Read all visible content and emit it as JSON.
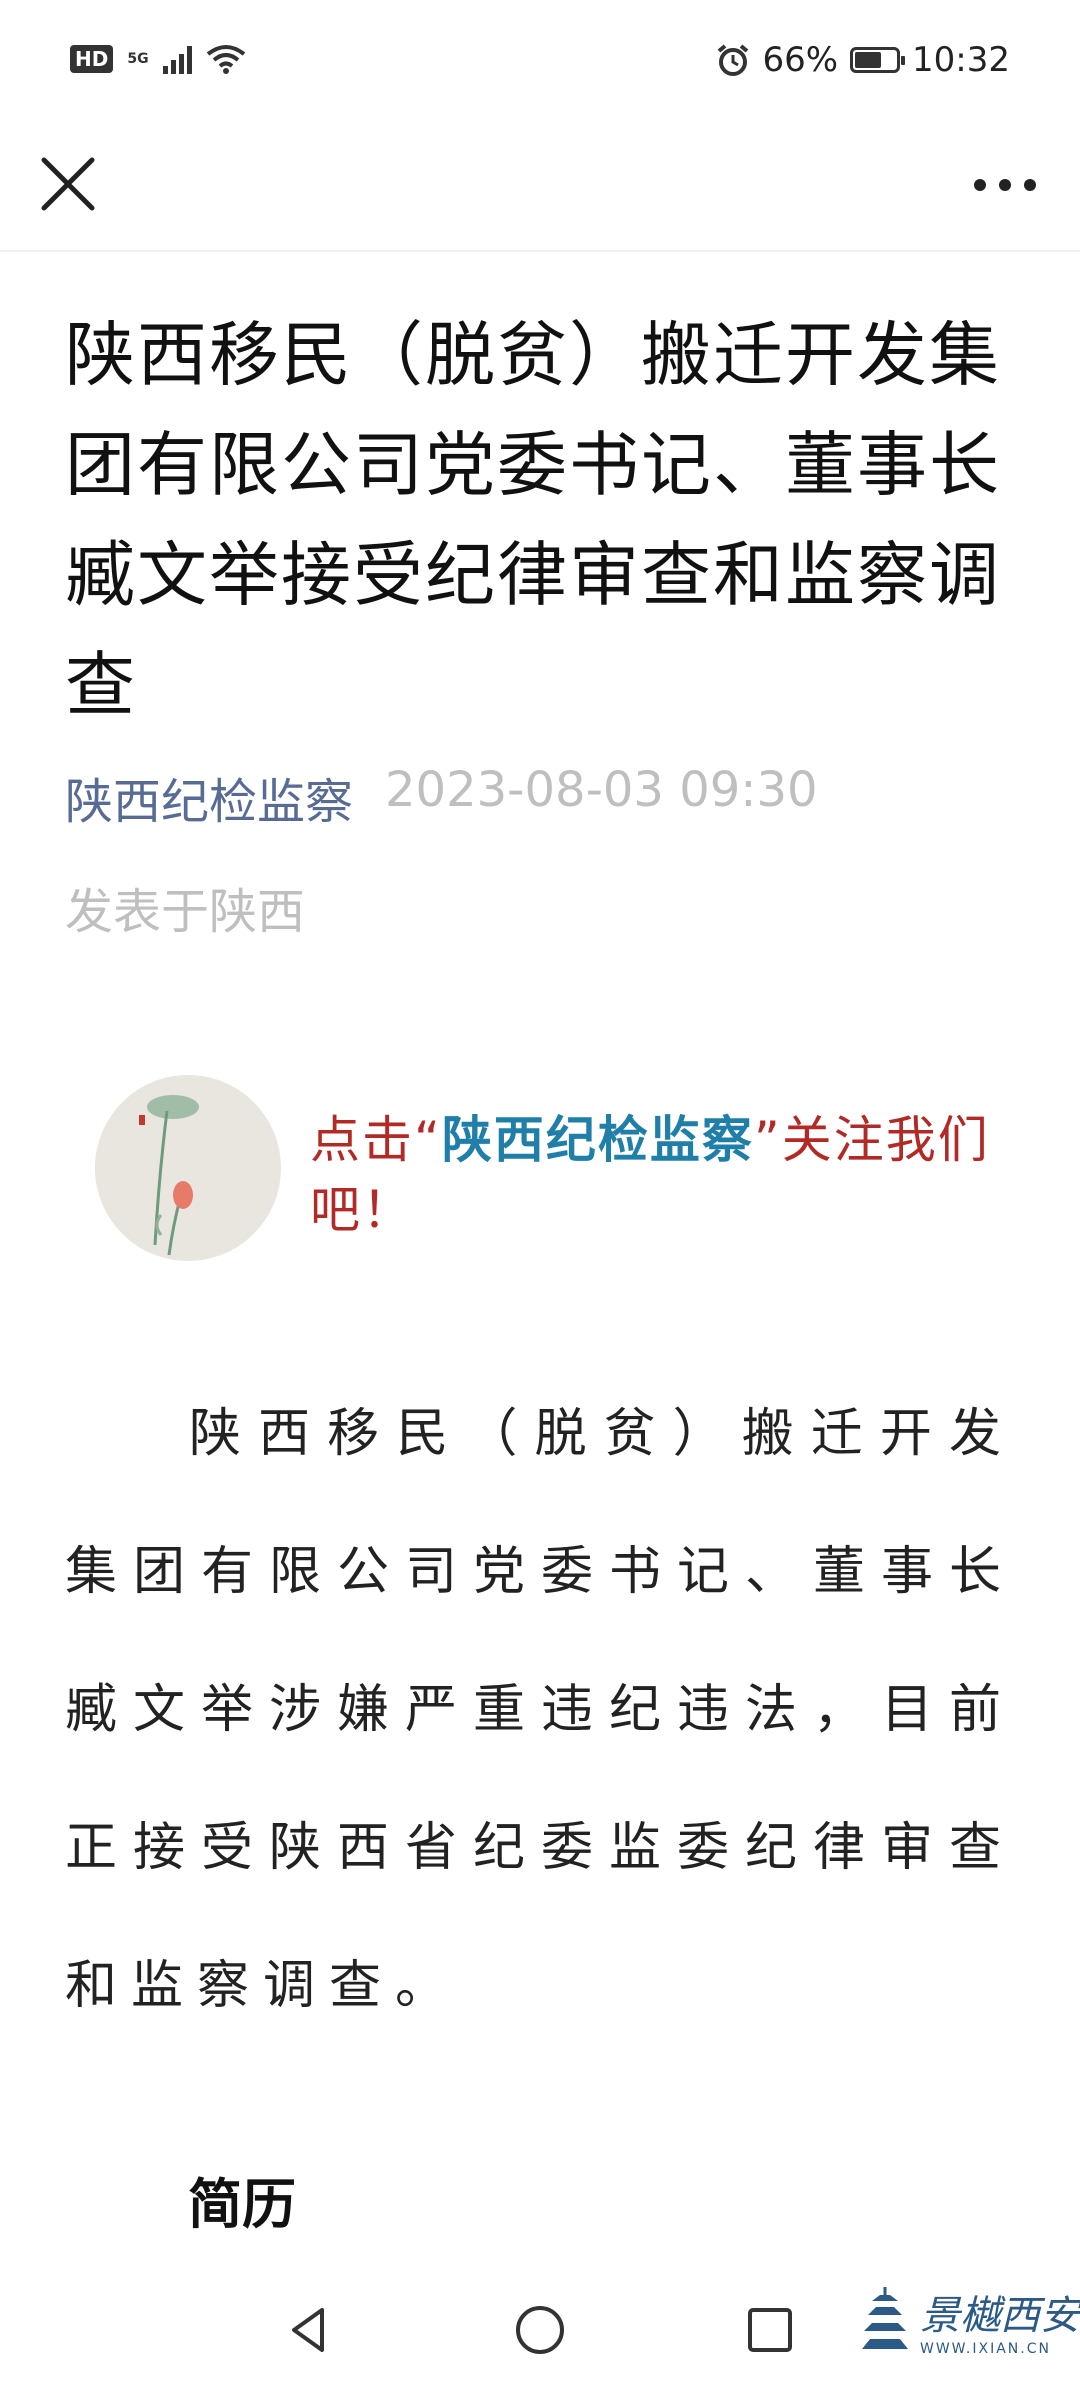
{
  "status_bar": {
    "hd": "HD",
    "network": "5G",
    "battery_pct": "66%",
    "battery_level": 0.66,
    "time": "10:32"
  },
  "icons": {
    "close": "close-icon",
    "more": "more-icon",
    "alarm": "alarm-icon",
    "wifi": "wifi-icon",
    "back": "back-triangle-icon",
    "home": "home-circle-icon",
    "recent": "recent-square-icon"
  },
  "article": {
    "title": "陕西移民（脱贫）搬迁开发集团有限公司党委书记、董事长臧文举接受纪律审查和监察调查",
    "account": "陕西纪检监察",
    "publish_time": "2023-08-03 09:30",
    "location": "发表于陕西",
    "follow_prefix": "点击“",
    "follow_account": "陕西纪检监察",
    "follow_suffix": "”关注我们吧！",
    "paragraph": "陕西移民（脱贫）搬迁开发集团有限公司党委书记、董事长臧文举涉嫌严重违纪违法，目前正接受陕西省纪委监委纪律审查和监察调查。",
    "subheading": "简历"
  },
  "watermark": {
    "name": "景樾西安",
    "url": "WWW.IXIAN.CN"
  },
  "colors": {
    "account_link": "#576b95",
    "muted": "#bfbfbf",
    "follow_red": "#b22a25",
    "follow_blue": "#1f7fa8"
  }
}
